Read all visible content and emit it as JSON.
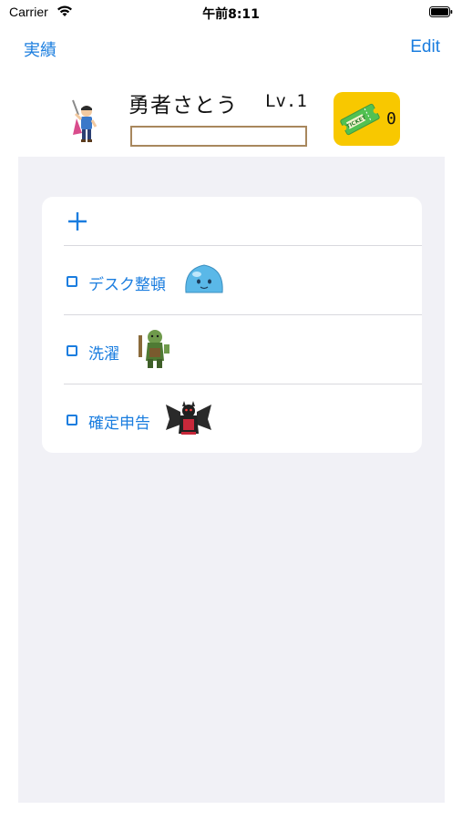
{
  "status_bar": {
    "carrier": "Carrier",
    "time": "午前8:11",
    "wifi_icon": "wifi-icon",
    "battery_icon": "battery-icon"
  },
  "nav": {
    "left_label": "実績",
    "right_label": "Edit"
  },
  "hero": {
    "name": "勇者さとう",
    "level": "Lv.1",
    "avatar_icon": "hero-avatar-icon",
    "xp_progress": 0
  },
  "ticket": {
    "icon": "ticket-icon",
    "count": "0"
  },
  "tasks": {
    "add_icon": "plus-icon",
    "items": [
      {
        "title": "デスク整頓",
        "done": false,
        "monster_icon": "slime-monster-icon"
      },
      {
        "title": "洗濯",
        "done": false,
        "monster_icon": "orc-monster-icon"
      },
      {
        "title": "確定申告",
        "done": false,
        "monster_icon": "demon-monster-icon"
      }
    ]
  },
  "colors": {
    "accent": "#1a7ddf",
    "background_panel": "#f1f1f6",
    "ticket_bg": "#f8c800",
    "xp_border": "#a8875d"
  }
}
